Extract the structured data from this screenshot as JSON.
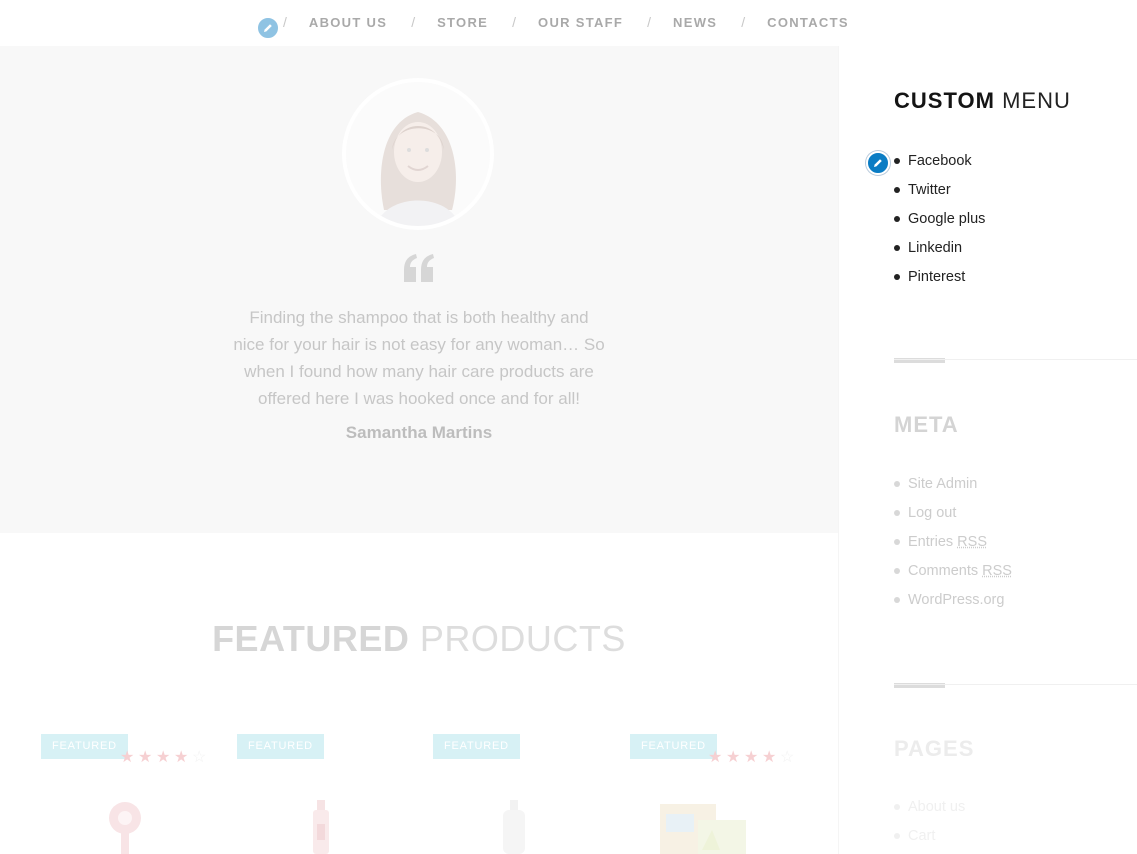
{
  "nav": {
    "items": [
      {
        "label": "ABOUT US"
      },
      {
        "label": "STORE"
      },
      {
        "label": "OUR STAFF"
      },
      {
        "label": "NEWS"
      },
      {
        "label": "CONTACTS"
      }
    ],
    "separator": "/"
  },
  "testimonial": {
    "quote": "Finding the shampoo that is both healthy and nice for your hair is not easy for any woman… So when I found how many hair care products are offered here I was hooked once and for all!",
    "author": "Samantha Martins"
  },
  "featured": {
    "title_strong": "FEATURED",
    "title_light": "PRODUCTS",
    "products": [
      {
        "badge": "FEATURED",
        "rating": 4
      },
      {
        "badge": "FEATURED",
        "rating": null
      },
      {
        "badge": "FEATURED",
        "rating": null
      },
      {
        "badge": "FEATURED",
        "rating": 4
      }
    ]
  },
  "sidebar": {
    "custom_menu": {
      "title_strong": "CUSTOM",
      "title_light": "MENU",
      "items": [
        "Facebook",
        "Twitter",
        "Google plus",
        "Linkedin",
        "Pinterest"
      ]
    },
    "meta": {
      "title": "META",
      "items": [
        "Site Admin",
        "Log out",
        "Entries",
        "Comments",
        "WordPress.org"
      ],
      "rss": "RSS"
    },
    "pages": {
      "title": "PAGES",
      "items": [
        "About us",
        "Cart"
      ]
    }
  },
  "colors": {
    "edit_accent": "#0a7cc4",
    "badge": "#d7f1f5",
    "star": "#f6d0d2"
  }
}
